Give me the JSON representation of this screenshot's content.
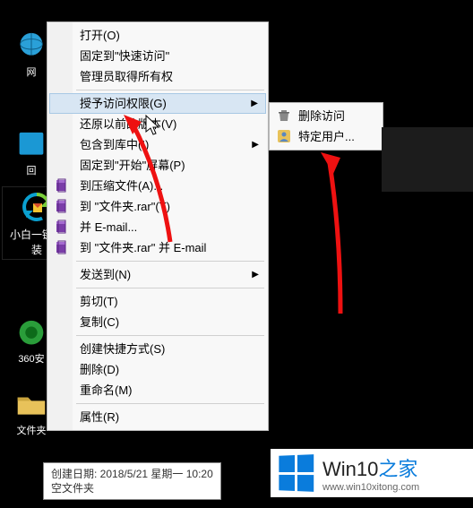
{
  "desktop": {
    "icons": [
      {
        "label": "网",
        "kind": "globe"
      },
      {
        "label": "回",
        "kind": "tile"
      },
      {
        "label": "360安",
        "kind": "sphere"
      },
      {
        "label": "文件夹",
        "kind": "folder"
      }
    ]
  },
  "app_panel": {
    "line1": "小白一键重",
    "line2": "装"
  },
  "menu": {
    "items": [
      {
        "label": "打开(O)",
        "icon": null,
        "submenu": false
      },
      {
        "label": "固定到\"快速访问\"",
        "icon": null,
        "submenu": false
      },
      {
        "label": "管理员取得所有权",
        "icon": null,
        "submenu": false
      },
      {
        "sep": true
      },
      {
        "label": "授予访问权限(G)",
        "icon": null,
        "submenu": true,
        "hover": true
      },
      {
        "label": "还原以前的版本(V)",
        "icon": null,
        "submenu": false
      },
      {
        "label": "包含到库中(I)",
        "icon": null,
        "submenu": true
      },
      {
        "label": "固定到\"开始\"屏幕(P)",
        "icon": null,
        "submenu": false
      },
      {
        "label": "到压缩文件(A)...",
        "icon": "rar",
        "submenu": false
      },
      {
        "label": "到 \"文件夹.rar\"(T)",
        "icon": "rar",
        "submenu": false
      },
      {
        "label": "并 E-mail...",
        "icon": "rar",
        "submenu": false
      },
      {
        "label": "到 \"文件夹.rar\" 并 E-mail",
        "icon": "rar",
        "submenu": false
      },
      {
        "sep": true
      },
      {
        "label": "发送到(N)",
        "icon": null,
        "submenu": true
      },
      {
        "sep": true
      },
      {
        "label": "剪切(T)",
        "icon": null,
        "submenu": false
      },
      {
        "label": "复制(C)",
        "icon": null,
        "submenu": false
      },
      {
        "sep": true
      },
      {
        "label": "创建快捷方式(S)",
        "icon": null,
        "submenu": false
      },
      {
        "label": "删除(D)",
        "icon": null,
        "submenu": false
      },
      {
        "label": "重命名(M)",
        "icon": null,
        "submenu": false
      },
      {
        "sep": true
      },
      {
        "label": "属性(R)",
        "icon": null,
        "submenu": false
      }
    ]
  },
  "submenu": {
    "items": [
      {
        "label": "删除访问",
        "icon": "trash"
      },
      {
        "label": "特定用户...",
        "icon": "user"
      }
    ]
  },
  "tooltip": {
    "line1": "创建日期: 2018/5/21 星期一 10:20",
    "line2": "空文件夹"
  },
  "watermark": {
    "brand_main": "Win10",
    "brand_accent": "之家",
    "url": "www.win10xitong.com"
  }
}
